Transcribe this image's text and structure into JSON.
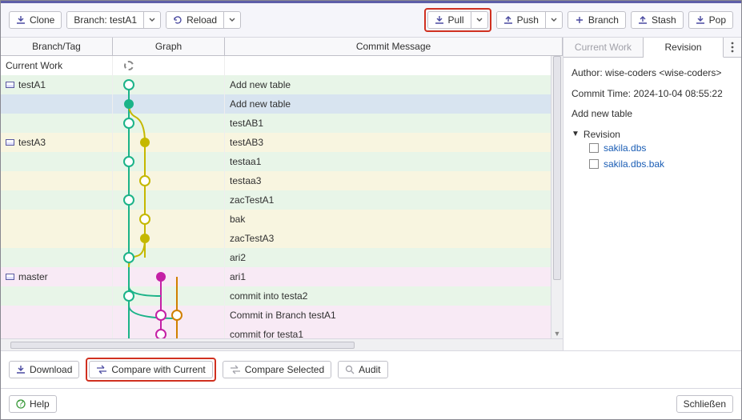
{
  "toolbar": {
    "clone": "Clone",
    "branch_label": "Branch: testA1",
    "reload": "Reload",
    "pull": "Pull",
    "push": "Push",
    "branch": "Branch",
    "stash": "Stash",
    "pop": "Pop"
  },
  "headers": {
    "branch_tag": "Branch/Tag",
    "graph": "Graph",
    "commit_msg": "Commit Message"
  },
  "rows": [
    {
      "bt": "Current Work",
      "msg": "",
      "type": "cw"
    },
    {
      "bt": "testA1",
      "msg": "Add new table",
      "type": "branch",
      "bg": "green"
    },
    {
      "bt": "",
      "msg": "Add new table",
      "type": "",
      "bg": "selected"
    },
    {
      "bt": "",
      "msg": "testAB1",
      "type": "",
      "bg": "green"
    },
    {
      "bt": "testA3",
      "msg": "testAB3",
      "type": "branch",
      "bg": "yellow"
    },
    {
      "bt": "",
      "msg": "testaa1",
      "type": "",
      "bg": "green"
    },
    {
      "bt": "",
      "msg": "testaa3",
      "type": "",
      "bg": "yellow"
    },
    {
      "bt": "",
      "msg": "zacTestA1",
      "type": "",
      "bg": "green"
    },
    {
      "bt": "",
      "msg": "bak",
      "type": "",
      "bg": "yellow"
    },
    {
      "bt": "",
      "msg": "zacTestA3",
      "type": "",
      "bg": "yellow"
    },
    {
      "bt": "",
      "msg": "ari2",
      "type": "",
      "bg": "green"
    },
    {
      "bt": "master",
      "msg": "ari1",
      "type": "branch",
      "bg": "pink"
    },
    {
      "bt": "",
      "msg": "commit into testa2",
      "type": "",
      "bg": "green"
    },
    {
      "bt": "",
      "msg": "Commit in Branch testA1",
      "type": "",
      "bg": "pink"
    },
    {
      "bt": "",
      "msg": "commit for testa1",
      "type": "",
      "bg": "pink"
    }
  ],
  "right": {
    "tabs": {
      "current": "Current Work",
      "revision": "Revision"
    },
    "author": "Author: wise-coders <wise-coders>",
    "commit_time": "Commit Time: 2024-10-04 08:55:22",
    "commit_msg": "Add new table",
    "tree_root": "Revision",
    "files": [
      "sakila.dbs",
      "sakila.dbs.bak"
    ]
  },
  "footer": {
    "download": "Download",
    "compare_current": "Compare with Current",
    "compare_selected": "Compare Selected",
    "audit": "Audit",
    "help": "Help",
    "close": "Schließen"
  }
}
